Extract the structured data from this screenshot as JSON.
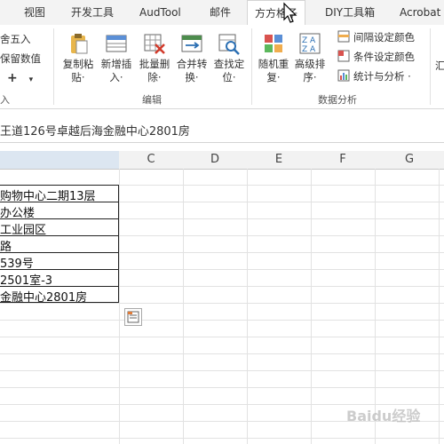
{
  "tabs": [
    {
      "label": "视图"
    },
    {
      "label": "开发工具"
    },
    {
      "label": "AudTool"
    },
    {
      "label": "邮件"
    },
    {
      "label": "方方格子"
    },
    {
      "label": "DIY工具箱"
    },
    {
      "label": "Acrobat"
    }
  ],
  "ribbon": {
    "left_partial": {
      "row1": "舍五入",
      "row2": "保留数值",
      "row3_symbol": "+",
      "group_label": "入"
    },
    "buttons": [
      {
        "line1": "复制粘",
        "line2": "贴·"
      },
      {
        "line1": "新增插",
        "line2": "入·"
      },
      {
        "line1": "批量删",
        "line2": "除·"
      },
      {
        "line1": "合并转",
        "line2": "换·"
      },
      {
        "line1": "查找定",
        "line2": "位·"
      },
      {
        "line1": "随机重",
        "line2": "复·"
      },
      {
        "line1": "高级排",
        "line2": "序·"
      }
    ],
    "small_buttons": [
      {
        "label": "间隔设定颜色"
      },
      {
        "label": "条件设定颜色"
      },
      {
        "label": "统计与分析 ·"
      }
    ],
    "group_labels": {
      "edit": "编辑",
      "analysis": "数据分析"
    },
    "right_partial": "汇"
  },
  "formula_bar": {
    "value": "王道126号卓越后海金融中心2801房"
  },
  "columns": [
    "C",
    "D",
    "E",
    "F",
    "G"
  ],
  "cells": [
    {
      "text": "购物中心二期13层"
    },
    {
      "text": "办公楼"
    },
    {
      "text": "工业园区"
    },
    {
      "text": "路"
    },
    {
      "text": "539号"
    },
    {
      "text": "2501室-3"
    },
    {
      "text": "金融中心2801房"
    }
  ],
  "watermark": "Baidu经验"
}
